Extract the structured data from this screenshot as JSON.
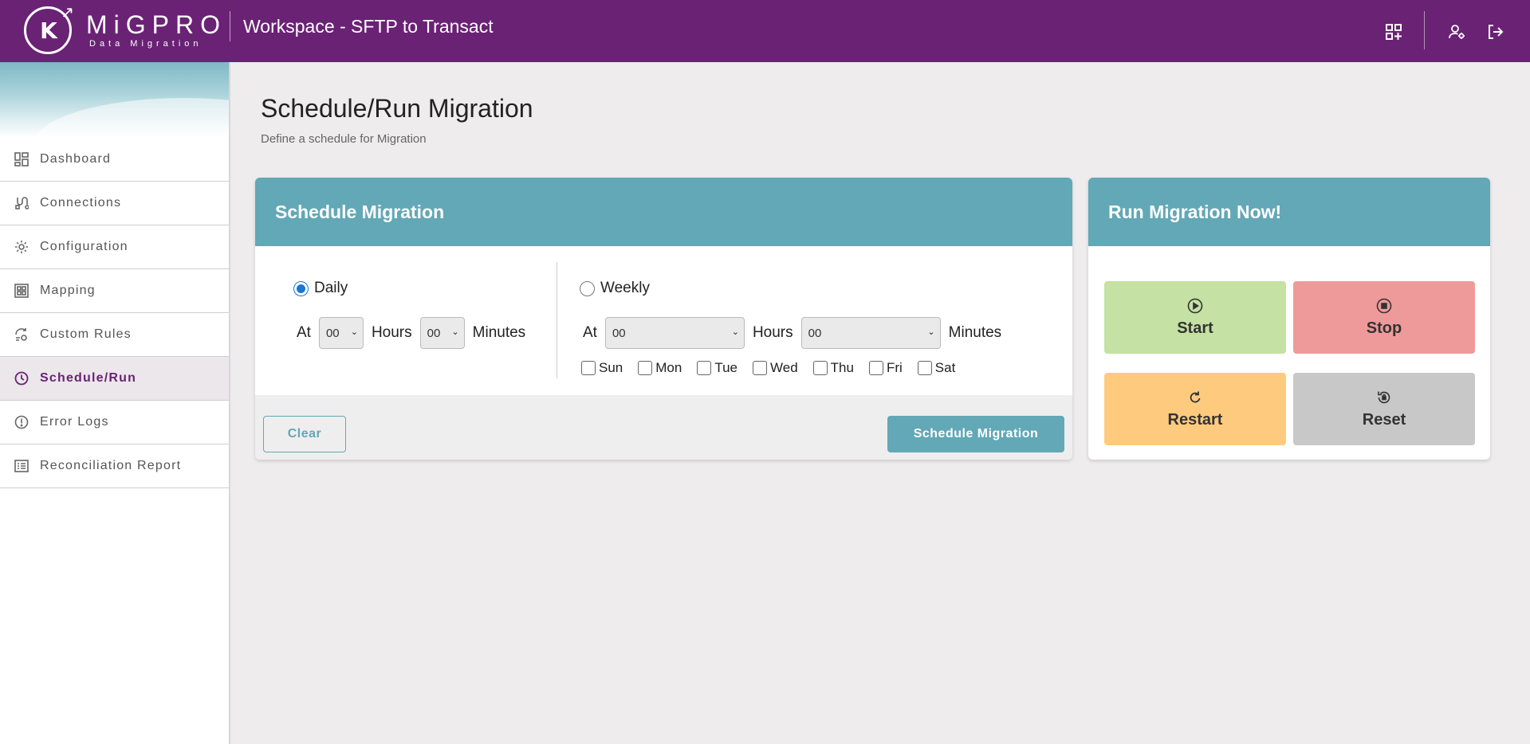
{
  "header": {
    "brand_name": "MiGPRO",
    "brand_sub": "Data Migration",
    "workspace_title": "Workspace - SFTP to Transact"
  },
  "sidebar": {
    "items": [
      {
        "label": "Dashboard",
        "icon": "dashboard-icon",
        "active": false
      },
      {
        "label": "Connections",
        "icon": "connections-icon",
        "active": false
      },
      {
        "label": "Configuration",
        "icon": "gear-icon",
        "active": false
      },
      {
        "label": "Mapping",
        "icon": "mapping-icon",
        "active": false
      },
      {
        "label": "Custom Rules",
        "icon": "custom-rules-icon",
        "active": false
      },
      {
        "label": "Schedule/Run",
        "icon": "clock-icon",
        "active": true
      },
      {
        "label": "Error Logs",
        "icon": "alert-icon",
        "active": false
      },
      {
        "label": "Reconciliation Report",
        "icon": "report-icon",
        "active": false
      }
    ]
  },
  "page": {
    "title": "Schedule/Run Migration",
    "subtitle": "Define a schedule for Migration"
  },
  "schedule": {
    "title": "Schedule Migration",
    "daily": {
      "label": "Daily",
      "selected": true,
      "at_label": "At",
      "hours_value": "00",
      "hours_label": "Hours",
      "minutes_value": "00",
      "minutes_label": "Minutes"
    },
    "weekly": {
      "label": "Weekly",
      "selected": false,
      "at_label": "At",
      "hours_value": "00",
      "hours_label": "Hours",
      "minutes_value": "00",
      "minutes_label": "Minutes",
      "days": [
        "Sun",
        "Mon",
        "Tue",
        "Wed",
        "Thu",
        "Fri",
        "Sat"
      ]
    },
    "clear_label": "Clear",
    "submit_label": "Schedule Migration"
  },
  "run": {
    "title": "Run Migration Now!",
    "start_label": "Start",
    "stop_label": "Stop",
    "restart_label": "Restart",
    "reset_label": "Reset"
  },
  "colors": {
    "brand": "#6a2275",
    "accent": "#62a8b6",
    "start": "#c5e1a3",
    "stop": "#ef9a9a",
    "restart": "#fecb7e",
    "reset": "#c8c8c8"
  }
}
